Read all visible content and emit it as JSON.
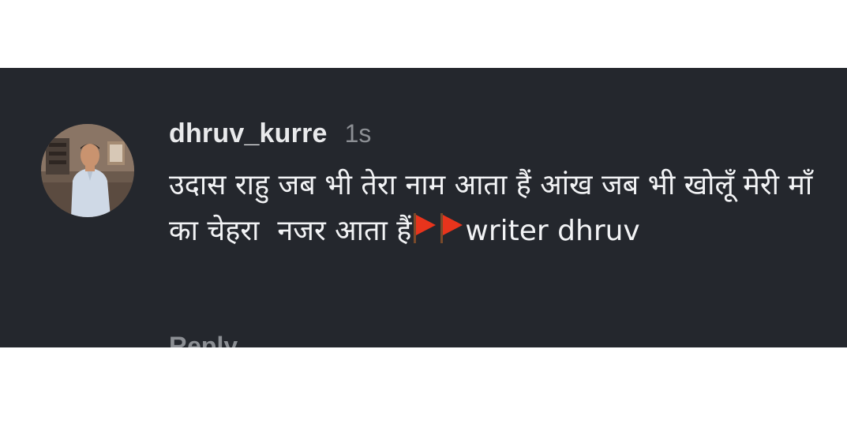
{
  "comment": {
    "username": "dhruv_kurre",
    "timestamp": "1s",
    "text_part1": "उदास राहु जब भी तेरा नाम आता हैं आंख जब भी खोलूँ मेरी माँ का चेहरा  नजर आता हैं",
    "text_part2": "writer dhruv",
    "flag_emoji_count": 2,
    "flag_color": "#e8341c",
    "reply_label": "Reply"
  },
  "colors": {
    "card_background": "#24272d",
    "primary_text": "#f2f3f5",
    "secondary_text": "#8c8f94"
  }
}
